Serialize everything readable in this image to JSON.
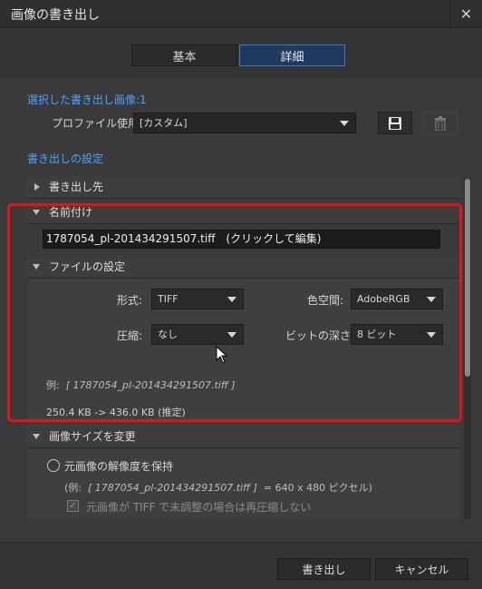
{
  "window": {
    "title": "画像の書き出し",
    "close_glyph": "✕"
  },
  "tabs": [
    {
      "label": "基本"
    },
    {
      "label": "詳細"
    }
  ],
  "selected_count_label": "選択した書き出し画像:1",
  "profile": {
    "label": "プロファイル使用:",
    "value": "[カスタム]"
  },
  "settings_label": "書き出しの設定",
  "sections": {
    "destination": "書き出し先",
    "naming": "名前付け",
    "file_settings": "ファイルの設定",
    "image_size": "画像サイズを変更"
  },
  "naming": {
    "filename": "1787054_pl-201434291507.tiff　(クリックして編集)"
  },
  "file_settings": {
    "format_label": "形式:",
    "format_value": "TIFF",
    "colorspace_label": "色空間:",
    "colorspace_value": "AdobeRGB",
    "compression_label": "圧縮:",
    "compression_value": "なし",
    "bitdepth_label": "ビットの深さ:",
    "bitdepth_value": "8 ビット",
    "example_prefix": "例:",
    "example_filename": "[ 1787054_pl-201434291507.tiff ]",
    "size_estimate": "250.4 KB -> 436.0 KB (推定)"
  },
  "image_size": {
    "radio_label": "元画像の解像度を保持",
    "example_prefix": "(例:",
    "example_filename": "[ 1787054_pl-201434291507.tiff ]",
    "example_suffix": "= 640 x 480 ピクセル)",
    "checkbox_label": "元画像が TIFF で未調整の場合は再圧縮しない",
    "checkbox_checked": true
  },
  "footer": {
    "export_label": "書き出し",
    "cancel_label": "キャンセル"
  },
  "colors": {
    "accent": "#4aa3ff",
    "highlight_box": "#e0141b",
    "active_tab": "#1f3a5c"
  }
}
